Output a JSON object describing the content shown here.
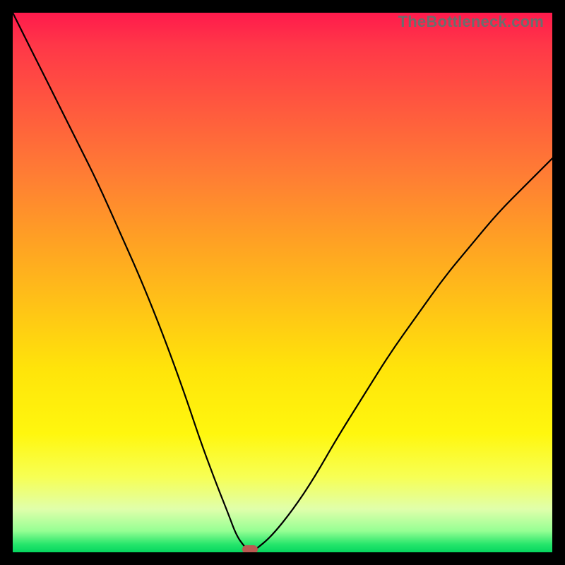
{
  "watermark": "TheBottleneck.com",
  "chart_data": {
    "type": "line",
    "title": "",
    "xlabel": "",
    "ylabel": "",
    "xlim": [
      0,
      100
    ],
    "ylim": [
      0,
      100
    ],
    "series": [
      {
        "name": "bottleneck-curve",
        "x": [
          0,
          2,
          5,
          8,
          12,
          16,
          20,
          24,
          28,
          32,
          35,
          38,
          40,
          41.5,
          43,
          44,
          45,
          48,
          52,
          56,
          60,
          65,
          70,
          75,
          80,
          85,
          90,
          95,
          100
        ],
        "y": [
          100,
          96,
          90,
          84,
          76,
          68,
          59,
          50,
          40,
          29,
          20,
          12,
          7,
          3,
          1,
          0,
          0.5,
          3,
          8,
          14,
          21,
          29,
          37,
          44,
          51,
          57,
          63,
          68,
          73
        ]
      }
    ],
    "marker": {
      "x": 44,
      "y": 0.5,
      "color": "#bb5a52"
    },
    "gradient_stops": [
      {
        "pos": 0,
        "color": "#ff1a4c"
      },
      {
        "pos": 0.3,
        "color": "#ff7d34"
      },
      {
        "pos": 0.66,
        "color": "#ffe40a"
      },
      {
        "pos": 0.92,
        "color": "#e0ffab"
      },
      {
        "pos": 1.0,
        "color": "#05d65f"
      }
    ]
  }
}
